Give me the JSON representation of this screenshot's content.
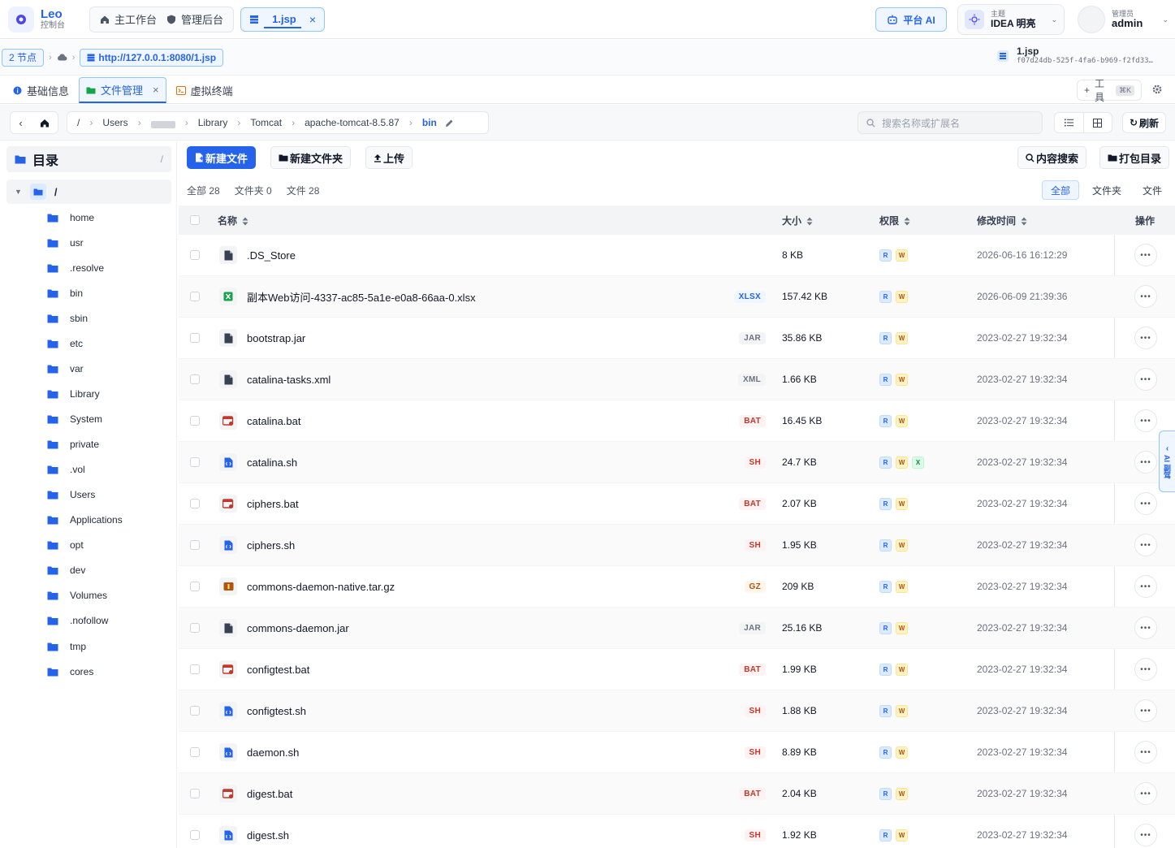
{
  "app": {
    "title": "Leo",
    "subtitle": "控制台"
  },
  "nav": {
    "workbench": "主工作台",
    "admin": "管理后台"
  },
  "open_tab": {
    "label": "1.jsp"
  },
  "ai_button": "平台 AI",
  "theme": {
    "caption": "主题",
    "value": "IDEA 明亮"
  },
  "user": {
    "role": "管理员",
    "name": "admin"
  },
  "session": {
    "nodes": "2 节点",
    "url": "http://127.0.0.1:8080/1.jsp",
    "file_name": "1.jsp",
    "file_id": "f07d24db-525f-4fa6-b969-f2fd33…"
  },
  "panel_tabs": {
    "info": "基础信息",
    "files": "文件管理",
    "terminal": "虚拟终端"
  },
  "tools": {
    "label": "工具",
    "shortcut": "⌘K"
  },
  "path": {
    "root": "/",
    "segments": [
      "Users",
      "Library",
      "Tomcat",
      "apache-tomcat-8.5.87"
    ],
    "current": "bin"
  },
  "search": {
    "placeholder": "搜索名称或扩展名"
  },
  "refresh_label": "刷新",
  "sidebar": {
    "title": "目录",
    "title_path": "/",
    "root": "/",
    "items": [
      "home",
      "usr",
      ".resolve",
      "bin",
      "sbin",
      "etc",
      "var",
      "Library",
      "System",
      "private",
      ".vol",
      "Users",
      "Applications",
      "opt",
      "dev",
      "Volumes",
      ".nofollow",
      "tmp",
      "cores"
    ]
  },
  "actions": {
    "new_file": "新建文件",
    "new_folder": "新建文件夹",
    "upload": "上传",
    "content_search": "内容搜索",
    "pack_dir": "打包目录"
  },
  "counts": {
    "all": "全部 28",
    "folders": "文件夹 0",
    "files": "文件 28"
  },
  "filters": {
    "all": "全部",
    "folders": "文件夹",
    "files": "文件"
  },
  "columns": {
    "name": "名称",
    "size": "大小",
    "perm": "权限",
    "mtime": "修改时间",
    "ops": "操作"
  },
  "perm_labels": {
    "r": "R",
    "w": "W",
    "x": "X"
  },
  "files": [
    {
      "name": ".DS_Store",
      "ext": "",
      "size": "8 KB",
      "perm": [
        "r",
        "w"
      ],
      "mtime": "2026-06-16 16:12:29",
      "kind": "doc"
    },
    {
      "name": "副本Web访问-4337-ac85-5a1e-e0a8-66aa-0.xlsx",
      "ext": "XLSX",
      "size": "157.42 KB",
      "perm": [
        "r",
        "w"
      ],
      "mtime": "2026-06-09 21:39:36",
      "kind": "xlsx"
    },
    {
      "name": "bootstrap.jar",
      "ext": "JAR",
      "size": "35.86 KB",
      "perm": [
        "r",
        "w"
      ],
      "mtime": "2023-02-27 19:32:34",
      "kind": "doc"
    },
    {
      "name": "catalina-tasks.xml",
      "ext": "XML",
      "size": "1.66 KB",
      "perm": [
        "r",
        "w"
      ],
      "mtime": "2023-02-27 19:32:34",
      "kind": "doc"
    },
    {
      "name": "catalina.bat",
      "ext": "BAT",
      "size": "16.45 KB",
      "perm": [
        "r",
        "w"
      ],
      "mtime": "2023-02-27 19:32:34",
      "kind": "bat"
    },
    {
      "name": "catalina.sh",
      "ext": "SH",
      "size": "24.7 KB",
      "perm": [
        "r",
        "w",
        "x"
      ],
      "mtime": "2023-02-27 19:32:34",
      "kind": "sh"
    },
    {
      "name": "ciphers.bat",
      "ext": "BAT",
      "size": "2.07 KB",
      "perm": [
        "r",
        "w"
      ],
      "mtime": "2023-02-27 19:32:34",
      "kind": "bat"
    },
    {
      "name": "ciphers.sh",
      "ext": "SH",
      "size": "1.95 KB",
      "perm": [
        "r",
        "w"
      ],
      "mtime": "2023-02-27 19:32:34",
      "kind": "sh"
    },
    {
      "name": "commons-daemon-native.tar.gz",
      "ext": "GZ",
      "size": "209 KB",
      "perm": [
        "r",
        "w"
      ],
      "mtime": "2023-02-27 19:32:34",
      "kind": "gz"
    },
    {
      "name": "commons-daemon.jar",
      "ext": "JAR",
      "size": "25.16 KB",
      "perm": [
        "r",
        "w"
      ],
      "mtime": "2023-02-27 19:32:34",
      "kind": "doc"
    },
    {
      "name": "configtest.bat",
      "ext": "BAT",
      "size": "1.99 KB",
      "perm": [
        "r",
        "w"
      ],
      "mtime": "2023-02-27 19:32:34",
      "kind": "bat"
    },
    {
      "name": "configtest.sh",
      "ext": "SH",
      "size": "1.88 KB",
      "perm": [
        "r",
        "w"
      ],
      "mtime": "2023-02-27 19:32:34",
      "kind": "sh"
    },
    {
      "name": "daemon.sh",
      "ext": "SH",
      "size": "8.89 KB",
      "perm": [
        "r",
        "w"
      ],
      "mtime": "2023-02-27 19:32:34",
      "kind": "sh"
    },
    {
      "name": "digest.bat",
      "ext": "BAT",
      "size": "2.04 KB",
      "perm": [
        "r",
        "w"
      ],
      "mtime": "2023-02-27 19:32:34",
      "kind": "bat"
    },
    {
      "name": "digest.sh",
      "ext": "SH",
      "size": "1.92 KB",
      "perm": [
        "r",
        "w"
      ],
      "mtime": "2023-02-27 19:32:34",
      "kind": "sh"
    }
  ],
  "ai_side": "AI 副驾",
  "colors": {
    "accent": "#2563eb",
    "bat": "#c0392b",
    "sh": "#c0392b",
    "gz": "#b45309",
    "xlsx": "#15803d"
  }
}
